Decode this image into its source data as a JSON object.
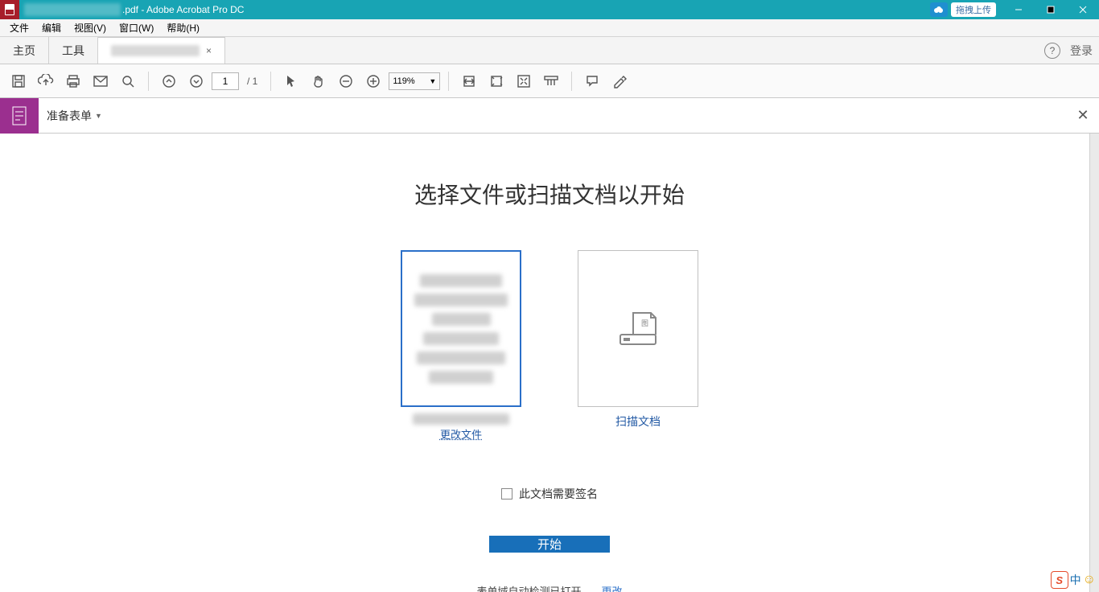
{
  "titlebar": {
    "title_suffix": ".pdf - Adobe Acrobat Pro DC",
    "upload_label": "拖拽上传"
  },
  "menubar": {
    "items": [
      "文件",
      "编辑",
      "视图(V)",
      "窗口(W)",
      "帮助(H)"
    ]
  },
  "apptabs": {
    "home": "主页",
    "tools": "工具",
    "login": "登录"
  },
  "toolbar": {
    "page_current": "1",
    "page_total": "/ 1",
    "zoom": "119%"
  },
  "subbar": {
    "label": "准备表单"
  },
  "main": {
    "heading": "选择文件或扫描文档以开始",
    "scan_label": "扫描文档",
    "change_file": "更改文件",
    "signature_checkbox": "此文档需要签名",
    "start_button": "开始",
    "autodetect_note": "表单域自动检测已打开。",
    "change_link": "更改"
  },
  "tray": {
    "cn": "中"
  }
}
